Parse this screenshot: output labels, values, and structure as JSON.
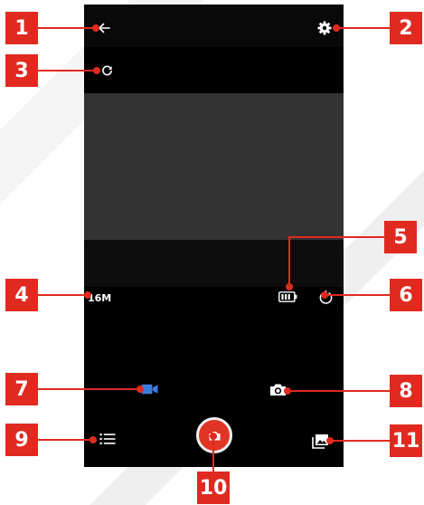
{
  "camera_screen": {
    "resolution_label": "16M"
  },
  "callouts": [
    "1",
    "2",
    "3",
    "4",
    "5",
    "6",
    "7",
    "8",
    "9",
    "10",
    "11"
  ],
  "colors": {
    "callout_red": "#e02a20",
    "shutter_red": "#e03525",
    "video_blue": "#3b7ddd",
    "screen_black": "#000000",
    "preview_gray": "#333333"
  },
  "icons": {
    "back": "arrow-left-icon",
    "settings": "gear-icon",
    "refresh": "refresh-icon",
    "battery": "battery-icon",
    "power": "power-icon",
    "video_mode": "video-camera-icon",
    "photo_mode": "camera-icon",
    "menu": "list-icon",
    "shutter": "shutter-camera-icon",
    "gallery": "gallery-icon"
  }
}
